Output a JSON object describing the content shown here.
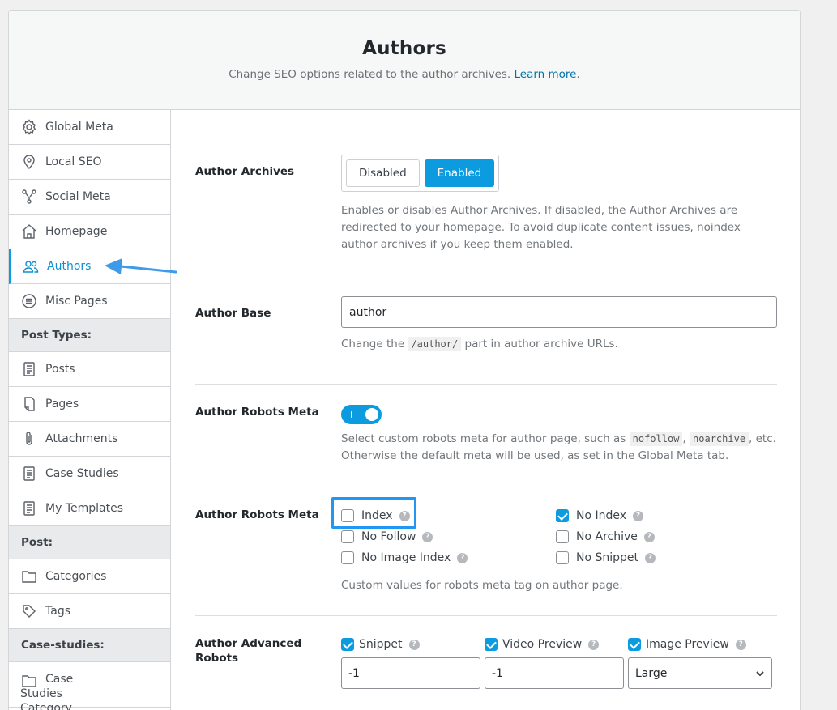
{
  "header": {
    "title": "Authors",
    "description": "Change SEO options related to the author archives.",
    "learn_more": "Learn more",
    "period": "."
  },
  "sidebar": {
    "items": [
      {
        "label": "Global Meta",
        "icon": "gear-icon"
      },
      {
        "label": "Local SEO",
        "icon": "map-pin-icon"
      },
      {
        "label": "Social Meta",
        "icon": "share-network-icon"
      },
      {
        "label": "Homepage",
        "icon": "home-icon"
      },
      {
        "label": "Authors",
        "icon": "users-icon",
        "active": true
      },
      {
        "label": "Misc Pages",
        "icon": "list-circle-icon"
      }
    ],
    "section_post_types": "Post Types:",
    "post_types": [
      {
        "label": "Posts",
        "icon": "document-icon"
      },
      {
        "label": "Pages",
        "icon": "pages-icon"
      },
      {
        "label": "Attachments",
        "icon": "paperclip-icon"
      },
      {
        "label": "Case Studies",
        "icon": "document-icon"
      },
      {
        "label": "My Templates",
        "icon": "document-icon"
      }
    ],
    "section_post": "Post:",
    "post_taxonomies": [
      {
        "label": "Categories",
        "icon": "folder-icon"
      },
      {
        "label": "Tags",
        "icon": "tag-icon"
      }
    ],
    "section_case_studies": "Case-studies:",
    "case_taxonomies": [
      {
        "label": "Case Studies Category",
        "icon": "folder-icon"
      }
    ]
  },
  "author_archives": {
    "label": "Author Archives",
    "options": [
      "Disabled",
      "Enabled"
    ],
    "selected": "Enabled",
    "help": "Enables or disables Author Archives. If disabled, the Author Archives are redirected to your homepage. To avoid duplicate content issues, noindex author archives if you keep them enabled."
  },
  "author_base": {
    "label": "Author Base",
    "value": "author",
    "help_before": "Change the",
    "help_code": "/author/",
    "help_after": "part in author archive URLs."
  },
  "robots_toggle": {
    "label": "Author Robots Meta",
    "enabled": true,
    "help_before": "Select custom robots meta for author page, such as",
    "code1": "nofollow",
    "comma": ",",
    "code2": "noarchive",
    "help_after": ", etc. Otherwise the default meta will be used, as set in the Global Meta tab."
  },
  "robots_meta": {
    "label": "Author Robots Meta",
    "left": [
      {
        "label": "Index",
        "checked": false
      },
      {
        "label": "No Follow",
        "checked": false
      },
      {
        "label": "No Image Index",
        "checked": false
      }
    ],
    "right": [
      {
        "label": "No Index",
        "checked": true
      },
      {
        "label": "No Archive",
        "checked": false
      },
      {
        "label": "No Snippet",
        "checked": false
      }
    ],
    "help": "Custom values for robots meta tag on author page."
  },
  "advanced_robots": {
    "label_line1": "Author Advanced",
    "label_line2": "Robots",
    "columns": [
      {
        "label": "Snippet",
        "checked": true,
        "value": "-1"
      },
      {
        "label": "Video Preview",
        "checked": true,
        "value": "-1"
      },
      {
        "label": "Image Preview",
        "checked": true,
        "value": "Large"
      }
    ]
  },
  "help_icon_glyph": "?",
  "colors": {
    "accent": "#0d9be0",
    "highlight": "#2196f3",
    "arrow": "#3d9be9"
  }
}
